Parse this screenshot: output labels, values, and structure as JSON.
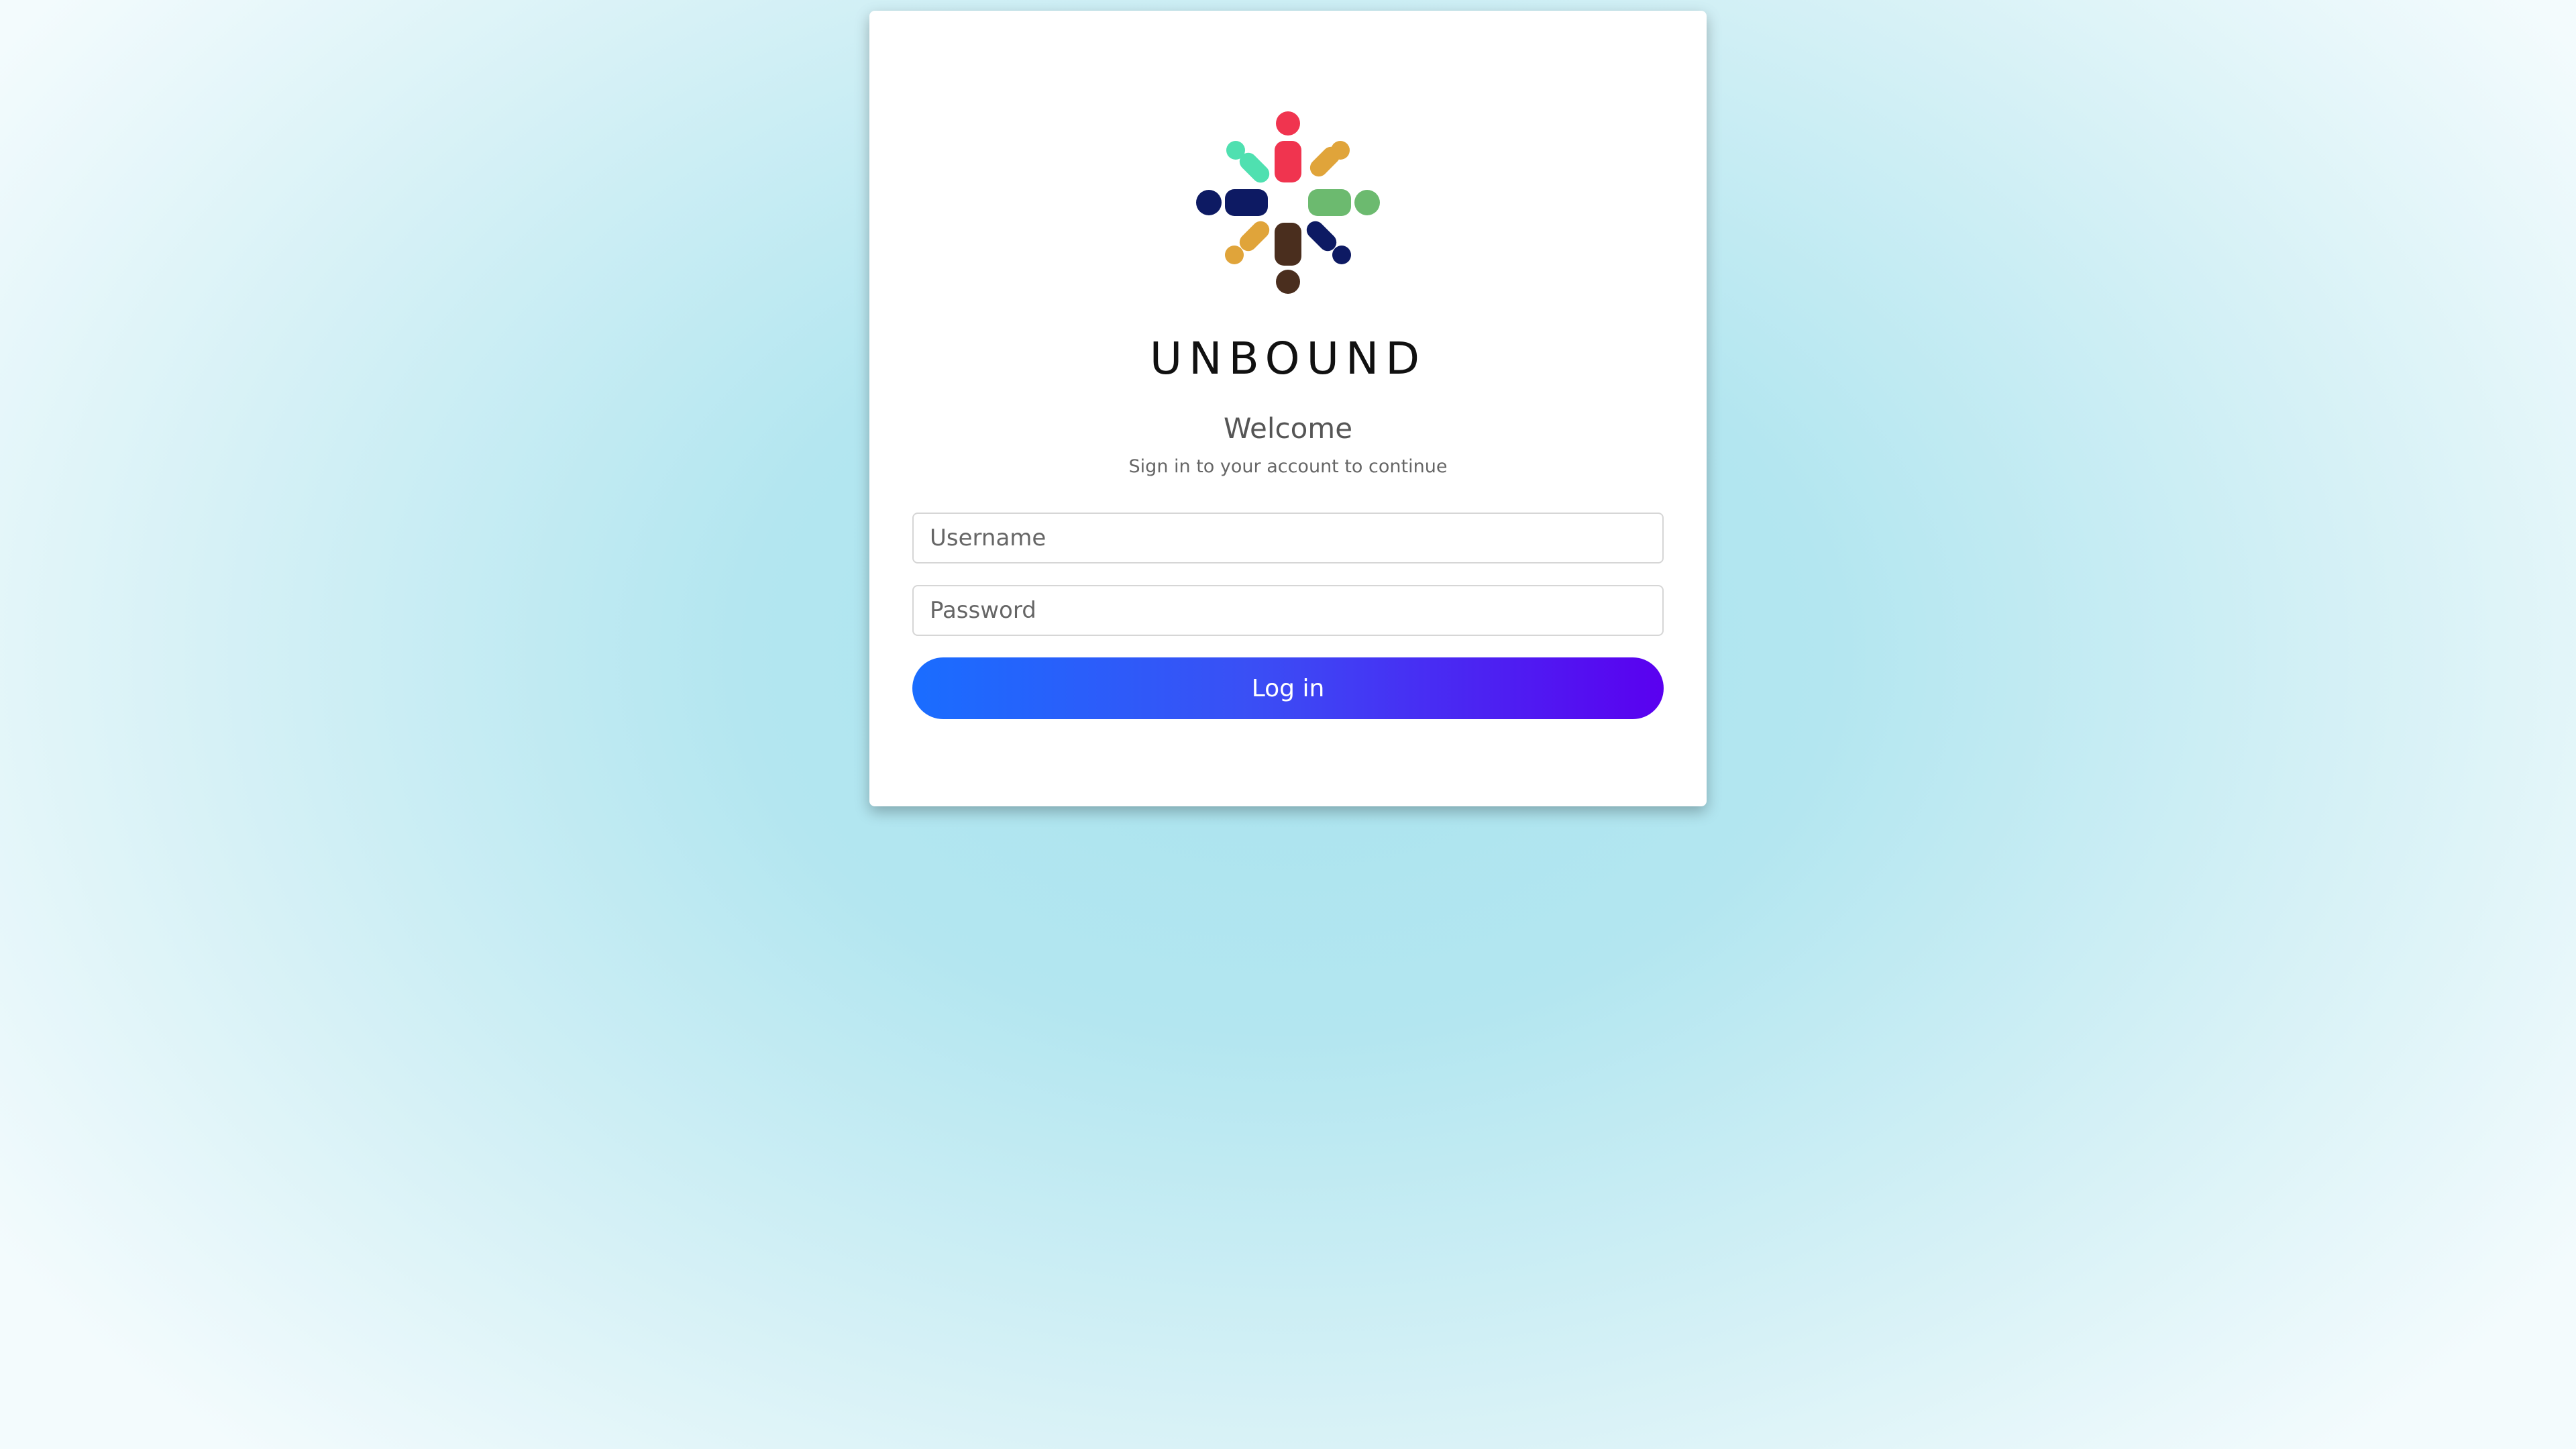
{
  "brand": {
    "name": "UNBOUND",
    "logo_icon": "unbound-logo-icon",
    "logo_colors": [
      "#f0344f",
      "#e0a43a",
      "#6cba6f",
      "#0d1a63",
      "#4a2e1e",
      "#4fe0b0"
    ]
  },
  "login": {
    "heading": "Welcome",
    "subheading": "Sign in to your account to continue",
    "username_placeholder": "Username",
    "password_placeholder": "Password",
    "submit_label": "Log in"
  },
  "colors": {
    "button_gradient_start": "#1a6dff",
    "button_gradient_end": "#5a00f0"
  }
}
